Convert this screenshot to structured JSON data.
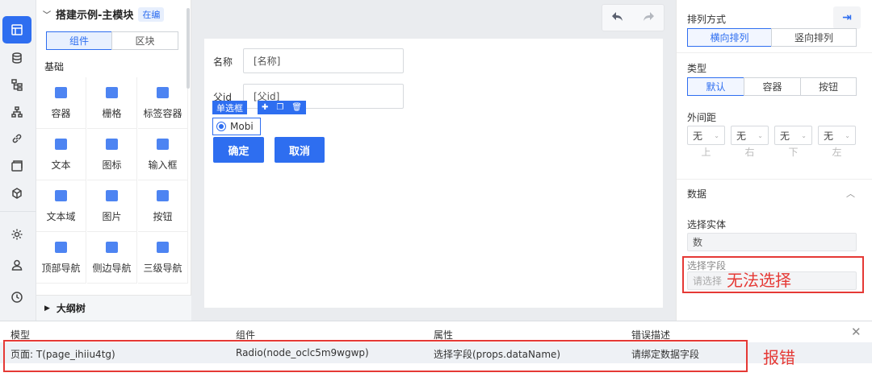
{
  "left_panel": {
    "title": "搭建示例-主模块",
    "status_tag": "在编",
    "tabs": [
      "组件",
      "区块"
    ],
    "section": "基础",
    "components": [
      "容器",
      "栅格",
      "标签容器",
      "文本",
      "图标",
      "输入框",
      "文本域",
      "图片",
      "按钮",
      "顶部导航",
      "侧边导航",
      "三级导航"
    ],
    "outline": "大纲树"
  },
  "canvas": {
    "fields": [
      {
        "label": "名称",
        "value": "[名称]"
      },
      {
        "label": "父id",
        "value": "[父id]"
      }
    ],
    "radio_tag": "单选框",
    "radio_option": "Mobi",
    "confirm": "确定",
    "cancel": "取消"
  },
  "props": {
    "arrange_label": "排列方式",
    "arrange_options": [
      "横向排列",
      "竖向排列"
    ],
    "type_label": "类型",
    "type_options": [
      "默认",
      "容器",
      "按钮"
    ],
    "margin_label": "外间距",
    "margin_value": "无",
    "margin_sides": [
      "上",
      "右",
      "下",
      "左"
    ],
    "data_section": "数据",
    "entity_label": "选择实体",
    "entity_value": "数",
    "field_label": "选择字段",
    "field_placeholder": "请选择",
    "annotation": "无法选择"
  },
  "errors": {
    "headers": [
      "模型",
      "组件",
      "属性",
      "错误描述"
    ],
    "row": [
      "页面: T(page_ihiiu4tg)",
      "Radio(node_oclc5m9wgwp)",
      "选择字段(props.dataName)",
      "请绑定数据字段"
    ],
    "annotation": "报错"
  },
  "colors": {
    "accent": "#2e6ef0",
    "error": "#e53935"
  }
}
